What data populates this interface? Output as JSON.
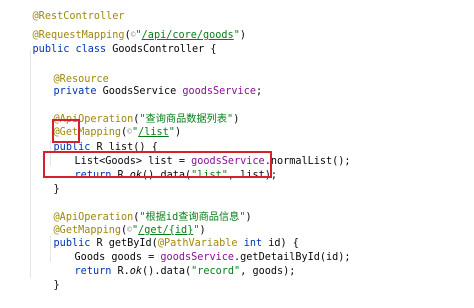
{
  "code": {
    "l1": {
      "ann": "@RestController"
    },
    "l2": {
      "ann": "@RequestMapping",
      "open": "(",
      "icon": "©",
      "str_q1": "\"",
      "path": "/api/core/goods",
      "str_q2": "\"",
      "close": ")"
    },
    "l3": {
      "kw": "public class ",
      "name": "GoodsController {"
    },
    "l4": {
      "ann": "@Resource"
    },
    "l5": {
      "kw": "private ",
      "type": "GoodsService ",
      "fld": "goodsService",
      "end": ";"
    },
    "l6": {
      "ann": "@ApiOperation",
      "open": "(",
      "str": "\"查询商品数据列表\"",
      "close": ")"
    },
    "l7": {
      "ann": "@GetMapping",
      "open": "(",
      "icon": "©",
      "str_q1": "\"",
      "path": "/list",
      "str_q2": "\"",
      "close": ")"
    },
    "l8": {
      "kw": "public ",
      "type": "R ",
      "name": "list() {"
    },
    "l9": {
      "text1": "List<Goods> list = ",
      "fld": "goodsService",
      "text2": ".normalList();"
    },
    "l10": {
      "kw": "return ",
      "text1": "R.",
      "it": "ok",
      "text2": "().data(",
      "str": "\"list\"",
      "text3": ", list);"
    },
    "l11": {
      "brace": "}"
    },
    "l12": {
      "ann": "@ApiOperation",
      "open": "(",
      "str": "\"根据id查询商品信息\"",
      "close": ")"
    },
    "l13": {
      "ann": "@GetMapping",
      "open": "(",
      "icon": "©",
      "str_q1": "\"",
      "path": "/get/{id}",
      "str_q2": "\"",
      "close": ")"
    },
    "l14": {
      "kw": "public ",
      "text1": "R getById(",
      "ann": "@PathVariable ",
      "kw2": "int ",
      "text2": "id) {"
    },
    "l15": {
      "text1": "Goods goods = ",
      "fld": "goodsService",
      "text2": ".getDetailById(id);"
    },
    "l16": {
      "kw": "return ",
      "text1": "R.",
      "it": "ok",
      "text2": "().data(",
      "str": "\"record\"",
      "text3": ", goods);"
    },
    "l17": {
      "brace": "}"
    }
  },
  "colors": {
    "annotation": "#9e880d",
    "keyword": "#0033b3",
    "string": "#067d17",
    "field": "#871094",
    "highlight_box": "#d6202d"
  }
}
